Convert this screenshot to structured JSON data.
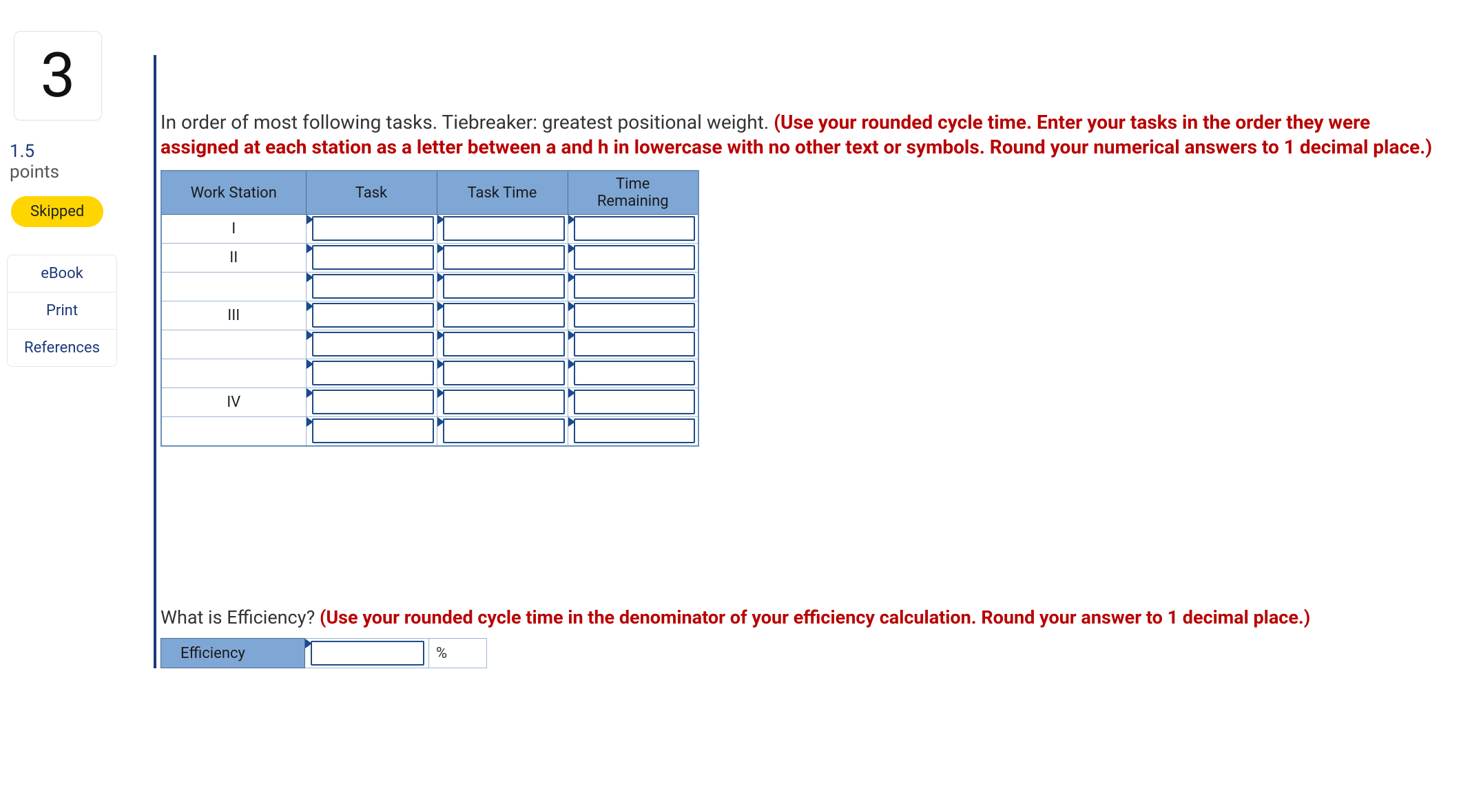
{
  "sidebar": {
    "question_number": "3",
    "points_value": "1.5",
    "points_label": "points",
    "status": "Skipped",
    "links": [
      "eBook",
      "Print",
      "References"
    ]
  },
  "question": {
    "text_plain": "In order of most following tasks. Tiebreaker: greatest positional weight. ",
    "text_red": "(Use your rounded cycle time. Enter your tasks in the order they were assigned at each station as a letter between a and h in lowercase with no other text or symbols. Round your numerical answers to 1 decimal place.)"
  },
  "table": {
    "headers": [
      "Work Station",
      "Task",
      "Task Time",
      "Time\nRemaining"
    ],
    "rows": [
      {
        "ws": "I"
      },
      {
        "ws": "II"
      },
      {
        "ws": ""
      },
      {
        "ws": "III"
      },
      {
        "ws": ""
      },
      {
        "ws": ""
      },
      {
        "ws": "IV"
      },
      {
        "ws": ""
      }
    ]
  },
  "efficiency": {
    "prompt_plain": " What is Efficiency? ",
    "prompt_red": "(Use your rounded cycle time in the denominator of your efficiency calculation. Round your answer to 1 decimal place.)",
    "label": "Efficiency",
    "unit": "%"
  }
}
